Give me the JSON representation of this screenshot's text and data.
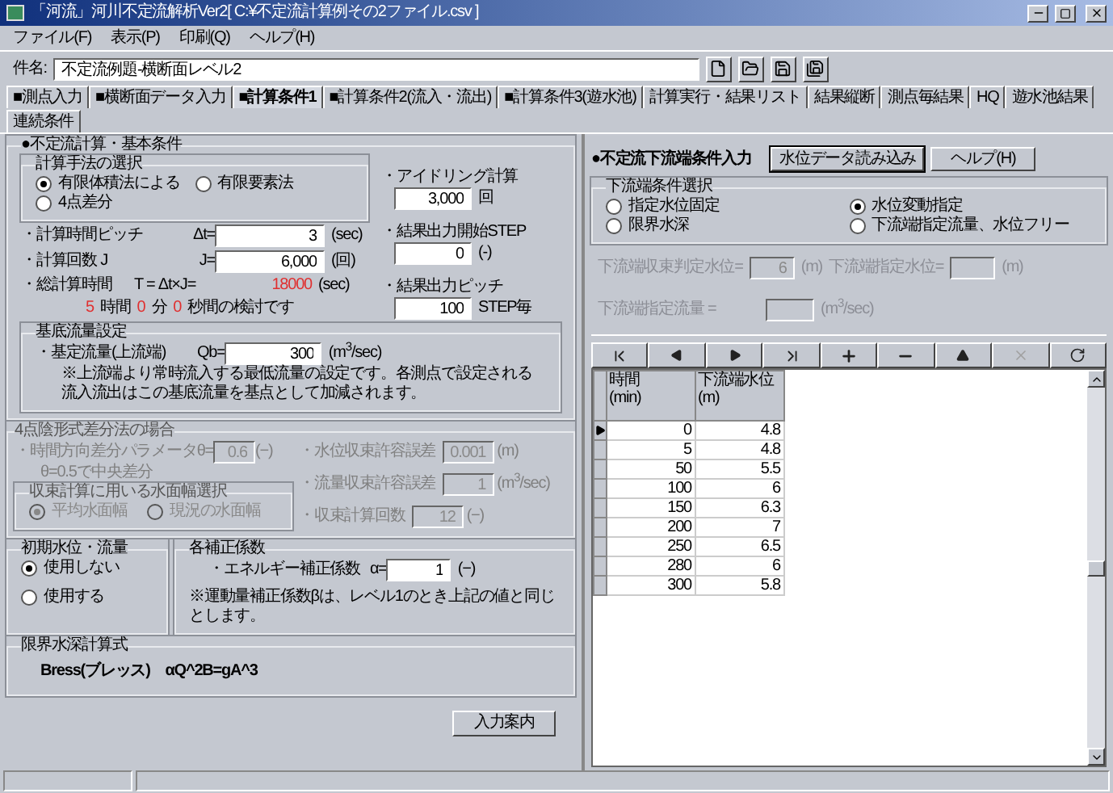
{
  "window": {
    "title": "「河流」河川不定流解析Ver2[ C:¥不定流計算例その2ファイル.csv ]"
  },
  "menu": [
    "ファイル(F)",
    "表示(P)",
    "印刷(Q)",
    "ヘルプ(H)"
  ],
  "subject": {
    "label": "件名:",
    "value": "不定流例題-横断面レベル2"
  },
  "tabs": [
    {
      "label": "■測点入力",
      "selected": false
    },
    {
      "label": "■横断面データ入力",
      "selected": false
    },
    {
      "label": "■計算条件1",
      "selected": true
    },
    {
      "label": "■計算条件2(流入・流出)",
      "selected": false
    },
    {
      "label": "■計算条件3(遊水池)",
      "selected": false
    },
    {
      "label": "計算実行・結果リスト",
      "selected": false
    },
    {
      "label": "結果縦断",
      "selected": false
    },
    {
      "label": "測点毎結果",
      "selected": false
    },
    {
      "label": "HQ",
      "selected": false
    },
    {
      "label": "遊水池結果",
      "selected": false
    },
    {
      "label": "連続条件",
      "selected": false
    }
  ],
  "basic": {
    "title": "●不定流計算・基本条件",
    "method": {
      "title": "計算手法の選択",
      "options": [
        {
          "label": "有限体積法による",
          "selected": true
        },
        {
          "label": "有限要素法",
          "selected": false
        },
        {
          "label": "4点差分",
          "selected": false
        }
      ]
    },
    "params": [
      {
        "label": "・計算時間ピッチ",
        "symbol": "Δt=",
        "value": "3",
        "unit": "(sec)"
      },
      {
        "label": "・計算回数 J",
        "symbol": "J=",
        "value": "6,000",
        "unit": "(回)"
      }
    ],
    "total": {
      "label": "・総計算時間",
      "formula": "T = Δt×J=",
      "value": "18000",
      "unit": "(sec)"
    },
    "duration": [
      {
        "value": "5",
        "unit": "時間"
      },
      {
        "value": "0",
        "unit": "分"
      },
      {
        "value": "0",
        "unit": "秒間の検討です"
      }
    ],
    "right_params": [
      {
        "label": "・アイドリング計算",
        "value": "3,000",
        "unit": "回"
      },
      {
        "label": "・結果出力開始STEP",
        "value": "0",
        "unit": "(-)"
      },
      {
        "label": "・結果出力ピッチ",
        "value": "100",
        "unit": "STEP毎"
      }
    ]
  },
  "base_flow": {
    "title": "基底流量設定",
    "label": "・基定流量(上流端)",
    "symbol": "Qb=",
    "value": "300",
    "unit": "(m$^{3}$/sec)",
    "note": "※上流端より常時流入する最低流量の設定です。各測点で設定される流入流出はこの基底流量を基点として加減されます。"
  },
  "four_point": {
    "title": "4点陰形式差分法の場合",
    "disabled": true,
    "fields": [
      {
        "label": "・時間方向差分パラメータ",
        "symbol": "θ=",
        "value": "0.6",
        "unit": "(−)"
      },
      {
        "label": "・水位収束許容誤差",
        "value": "0.001",
        "unit": "(m)"
      },
      {
        "label": "・流量収束許容誤差",
        "value": "1",
        "unit": "(m$^{3}$/sec)"
      },
      {
        "label": "・収束計算回数",
        "value": "12",
        "unit": "(−)"
      }
    ],
    "hint": "θ=0.5で中央差分",
    "width_choice": {
      "title": "収束計算に用いる水面幅選択",
      "options": [
        {
          "label": "平均水面幅",
          "selected": true
        },
        {
          "label": "現況の水面幅",
          "selected": false
        }
      ]
    }
  },
  "initial": {
    "title": "初期水位・流量",
    "options": [
      {
        "label": "使用しない",
        "selected": true
      },
      {
        "label": "使用する",
        "selected": false
      }
    ]
  },
  "correction": {
    "title": "各補正係数",
    "label": "・エネルギー補正係数",
    "symbol": "α=",
    "value": "1",
    "unit": "(−)",
    "note": "※運動量補正係数βは、レベル1のとき上記の値と同じとします。"
  },
  "critical": {
    "title": "限界水深計算式",
    "formula": "Bress(ブレッス)　αQ^2B=gA^3"
  },
  "guide_button": "入力案内",
  "downstream": {
    "title": "●不定流下流端条件入力",
    "buttons": [
      "水位データ読み込み",
      "ヘルプ(H)"
    ],
    "condition": {
      "title": "下流端条件選択",
      "options": [
        {
          "label": "指定水位固定",
          "selected": false
        },
        {
          "label": "水位変動指定",
          "selected": true
        },
        {
          "label": "限界水深",
          "selected": false
        },
        {
          "label": "下流端指定流量、水位フリー",
          "selected": false
        }
      ]
    },
    "fields_disabled": true,
    "fields": [
      {
        "label": "下流端収束判定水位=",
        "value": "6",
        "unit": "(m)"
      },
      {
        "label": "下流端指定水位=",
        "unit": "(m)"
      },
      {
        "label": "下流端指定流量 =",
        "unit": "(m$^{3}$/sec)"
      }
    ]
  },
  "navigator": [
    {
      "kind": "first",
      "disabled": false
    },
    {
      "kind": "prior",
      "disabled": false
    },
    {
      "kind": "next",
      "disabled": false
    },
    {
      "kind": "last",
      "disabled": false
    },
    {
      "kind": "insert",
      "disabled": false
    },
    {
      "kind": "delete",
      "disabled": false
    },
    {
      "kind": "edit",
      "disabled": false
    },
    {
      "kind": "cancel",
      "disabled": true
    },
    {
      "kind": "refresh",
      "disabled": false
    }
  ],
  "grid": {
    "columns": [
      {
        "label": "時間",
        "unit": "(min)"
      },
      {
        "label": "下流端水位",
        "unit": "(m)"
      }
    ],
    "rows": [
      {
        "cells": [
          "0",
          "4.8"
        ],
        "current": true
      },
      {
        "cells": [
          "5",
          "4.8"
        ],
        "current": false
      },
      {
        "cells": [
          "50",
          "5.5"
        ],
        "current": false
      },
      {
        "cells": [
          "100",
          "6"
        ],
        "current": false
      },
      {
        "cells": [
          "150",
          "6.3"
        ],
        "current": false
      },
      {
        "cells": [
          "200",
          "7"
        ],
        "current": false
      },
      {
        "cells": [
          "250",
          "6.5"
        ],
        "current": false
      },
      {
        "cells": [
          "280",
          "6"
        ],
        "current": false
      },
      {
        "cells": [
          "300",
          "5.8"
        ],
        "current": false
      }
    ]
  }
}
